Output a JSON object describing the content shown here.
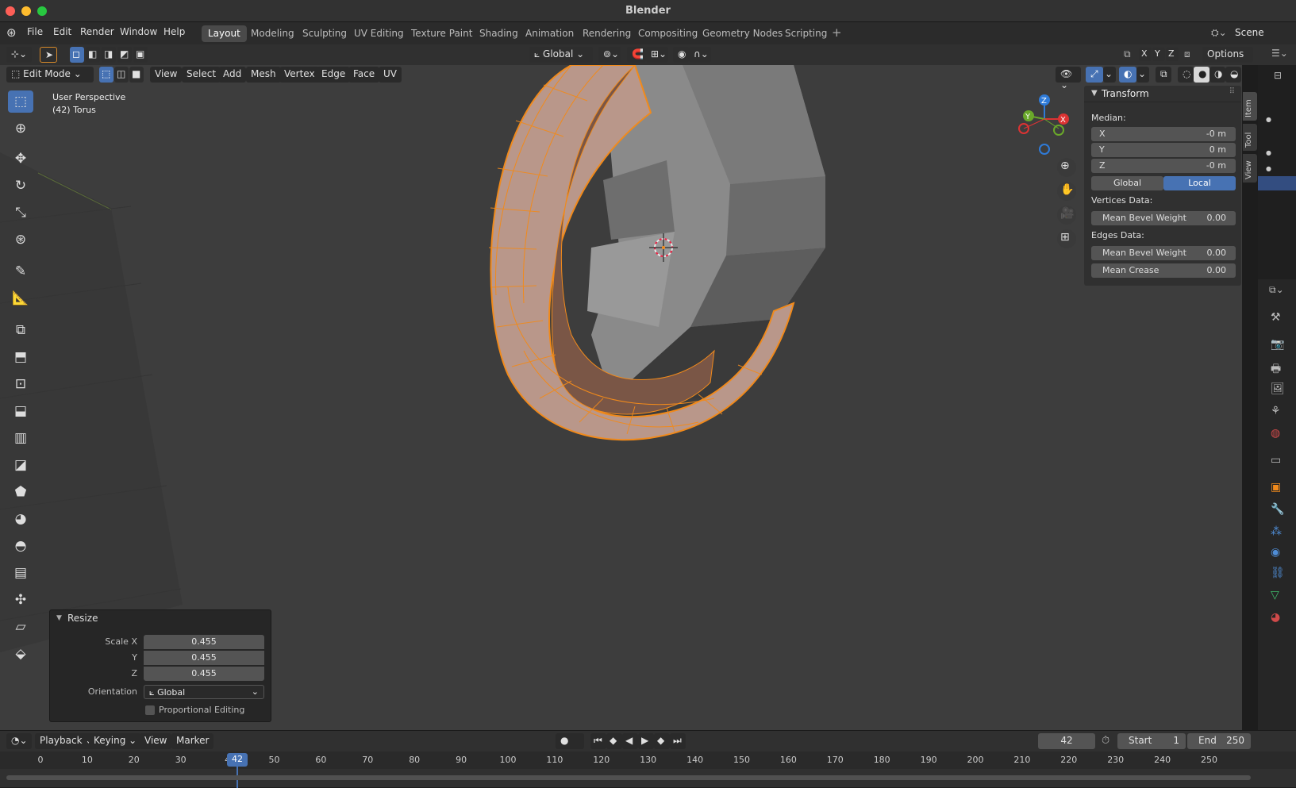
{
  "window": {
    "title": "Blender"
  },
  "menu": [
    "File",
    "Edit",
    "Render",
    "Window",
    "Help"
  ],
  "workspaces": [
    "Layout",
    "Modeling",
    "Sculpting",
    "UV Editing",
    "Texture Paint",
    "Shading",
    "Animation",
    "Rendering",
    "Compositing",
    "Geometry Nodes",
    "Scripting"
  ],
  "active_workspace": "Layout",
  "scene_label": "Scene",
  "header": {
    "orientation": "Global",
    "options": "Options",
    "axes": [
      "X",
      "Y",
      "Z"
    ]
  },
  "viewport_header": {
    "mode": "Edit Mode",
    "items": [
      "View",
      "Select",
      "Add",
      "Mesh",
      "Vertex",
      "Edge",
      "Face",
      "UV"
    ]
  },
  "viewport": {
    "perspective": "User Perspective",
    "object": "(42) Torus",
    "gizmo": {
      "x": "X",
      "y": "Y",
      "z": "Z"
    }
  },
  "npanel": {
    "section": "Transform",
    "median_label": "Median:",
    "fields": [
      {
        "key": "X",
        "value": "-0 m"
      },
      {
        "key": "Y",
        "value": "0 m"
      },
      {
        "key": "Z",
        "value": "-0 m"
      }
    ],
    "space_global": "Global",
    "space_local": "Local",
    "vertices_label": "Vertices Data:",
    "vertices_fields": [
      {
        "key": "Mean Bevel Weight",
        "value": "0.00"
      }
    ],
    "edges_label": "Edges Data:",
    "edges_fields": [
      {
        "key": "Mean Bevel Weight",
        "value": "0.00"
      },
      {
        "key": "Mean Crease",
        "value": "0.00"
      }
    ],
    "tabs": [
      "Item",
      "Tool",
      "View"
    ]
  },
  "resize_panel": {
    "title": "Resize",
    "scale_x_label": "Scale X",
    "scale_y_label": "Y",
    "scale_z_label": "Z",
    "scale_x": "0.455",
    "scale_y": "0.455",
    "scale_z": "0.455",
    "orientation_label": "Orientation",
    "orientation": "Global",
    "proportional_label": "Proportional Editing"
  },
  "timeline": {
    "menus": [
      "Playback",
      "Keying",
      "View",
      "Marker"
    ],
    "current_frame": "42",
    "start_label": "Start",
    "start": "1",
    "end_label": "End",
    "end": "250",
    "ticks": [
      "0",
      "10",
      "20",
      "30",
      "4",
      "50",
      "60",
      "70",
      "80",
      "90",
      "100",
      "110",
      "120",
      "130",
      "140",
      "150",
      "160",
      "170",
      "180",
      "190",
      "200",
      "210",
      "220",
      "230",
      "240",
      "250"
    ]
  }
}
